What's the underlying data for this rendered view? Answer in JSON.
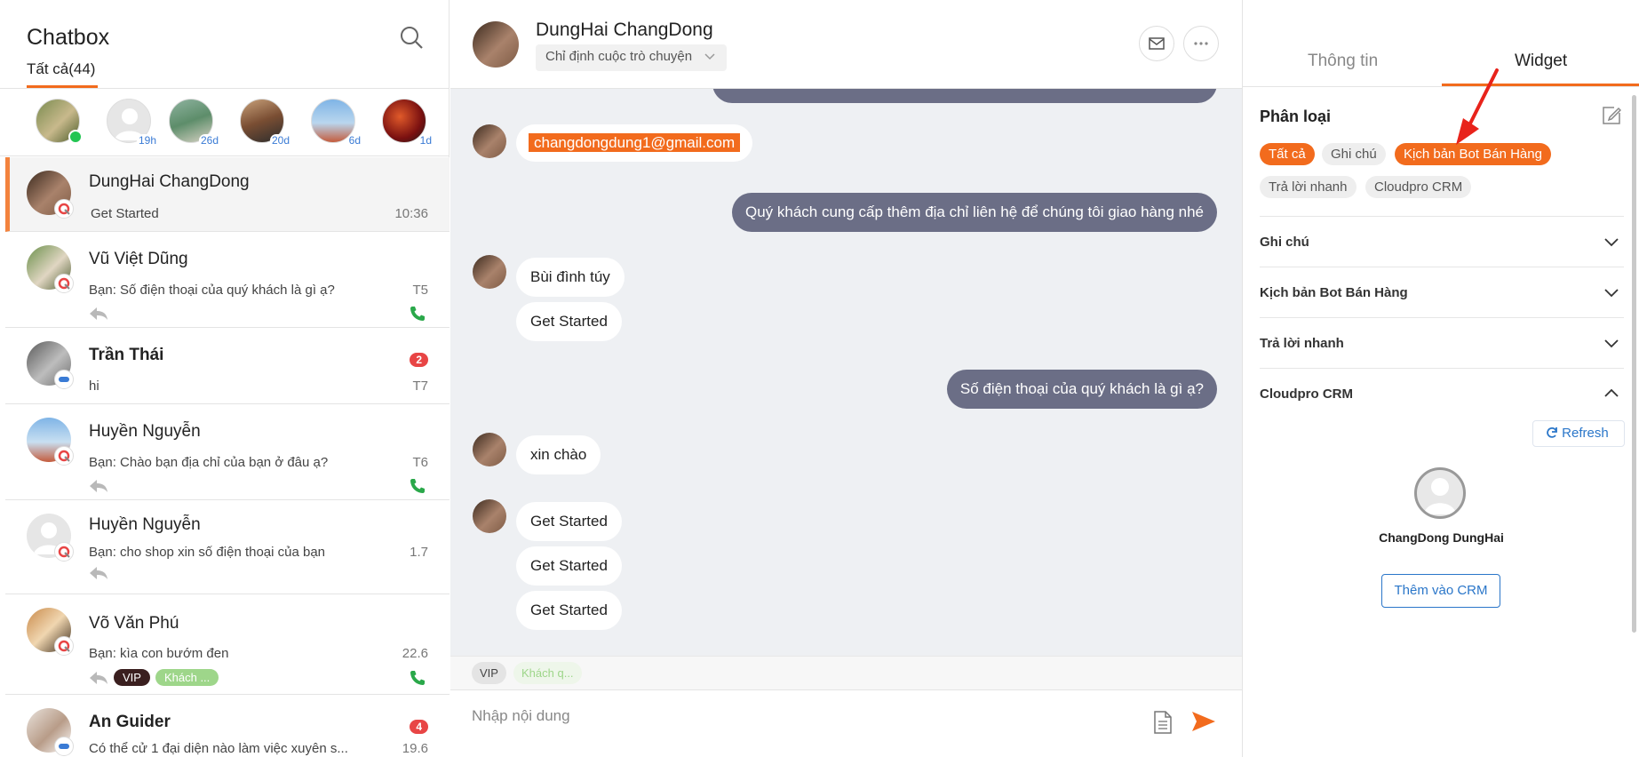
{
  "left": {
    "title": "Chatbox",
    "filter_tab": "Tất cả(44)",
    "stories": [
      {
        "tag": ""
      },
      {
        "tag": "19h"
      },
      {
        "tag": "26d"
      },
      {
        "tag": "20d"
      },
      {
        "tag": "6d"
      },
      {
        "tag": "1d"
      }
    ],
    "conversations": [
      {
        "name": "DungHai ChangDong",
        "message": "Get Started",
        "time": "10:36"
      },
      {
        "name": "Vũ Việt Dũng",
        "message": "Bạn: Số điện thoại của quý khách là gì ạ?",
        "time": "T5"
      },
      {
        "name": "Trần Thái",
        "message": "hi",
        "time": "T7",
        "unread": "2"
      },
      {
        "name": "Huyền Nguyễn",
        "message": "Bạn: Chào bạn địa chỉ của bạn ở đâu ạ?",
        "time": "T6"
      },
      {
        "name": "Huyền Nguyễn",
        "message": "Bạn: cho shop xin số điện thoại của bạn",
        "time": "1.7"
      },
      {
        "name": "Võ Văn Phú",
        "message": "Bạn: kìa con bướm đen",
        "time": "22.6",
        "tags": [
          "VIP",
          "Khách ..."
        ]
      },
      {
        "name": "An Guider",
        "message": "Có thể cử 1 đại diện nào làm việc xuyên s...",
        "time": "19.6",
        "unread": "4"
      }
    ]
  },
  "chat": {
    "contact_name": "DungHai ChangDong",
    "assign_label": "Chỉ định cuộc trò chuyện",
    "messages": {
      "email": "changdongdung1@gmail.com",
      "out_address": "Quý khách cung cấp thêm địa chỉ liên hệ để chúng tôi giao hàng nhé",
      "in_name": "Bùi đình túy",
      "in_started_1": "Get Started",
      "out_phone": "Số điện thoại của quý khách là gì ạ?",
      "in_hello": "xin chào",
      "in_started_2": "Get Started",
      "in_started_3": "Get Started",
      "in_started_4": "Get Started"
    },
    "tags": [
      "VIP",
      "Khách q..."
    ],
    "composer_placeholder": "Nhập nội dung"
  },
  "right": {
    "tabs": [
      "Thông tin",
      "Widget"
    ],
    "active_tab": "Widget",
    "section_title": "Phân loại",
    "chips": [
      "Tất cả",
      "Ghi chú",
      "Kịch bản Bot Bán Hàng",
      "Trả lời nhanh",
      "Cloudpro CRM"
    ],
    "accordions": [
      "Ghi chú",
      "Kịch bản Bot Bán Hàng",
      "Trả lời nhanh",
      "Cloudpro CRM"
    ],
    "refresh_label": "Refresh",
    "crm_contact_name": "ChangDong DungHai",
    "add_crm_label": "Thêm vào CRM"
  },
  "colors": {
    "accent": "#f26b1d",
    "outgoing_bubble": "#6b6e86",
    "link_blue": "#2a76c9",
    "online_green": "#23c552",
    "unread_red": "#e84545"
  }
}
